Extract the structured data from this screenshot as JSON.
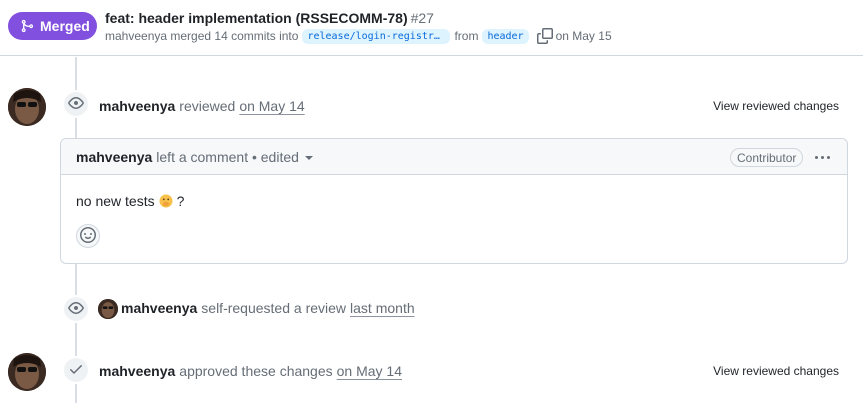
{
  "header": {
    "status_label": "Merged",
    "title": "feat: header implementation (RSSECOMM-78)",
    "number": "#27",
    "author": "mahveenya",
    "merged_text": "merged 14 commits into",
    "base_branch": "release/login-registration",
    "from_text": "from",
    "head_branch": "header",
    "date_text": "on May 15"
  },
  "timeline": {
    "review1": {
      "user": "mahveenya",
      "action": "reviewed",
      "time": "on May 14",
      "view_link": "View reviewed changes"
    },
    "comment": {
      "user": "mahveenya",
      "meta": "left a comment • edited",
      "role_badge": "Contributor",
      "body": "no new tests",
      "body_suffix": "?"
    },
    "request": {
      "user": "mahveenya",
      "action": "self-requested a review",
      "time": "last month"
    },
    "approval": {
      "user": "mahveenya",
      "action": "approved these changes",
      "time": "on May 14",
      "view_link": "View reviewed changes"
    }
  },
  "colors": {
    "merged": "#8250df",
    "branch_bg": "#ddf4ff",
    "branch_text": "#0969da"
  }
}
